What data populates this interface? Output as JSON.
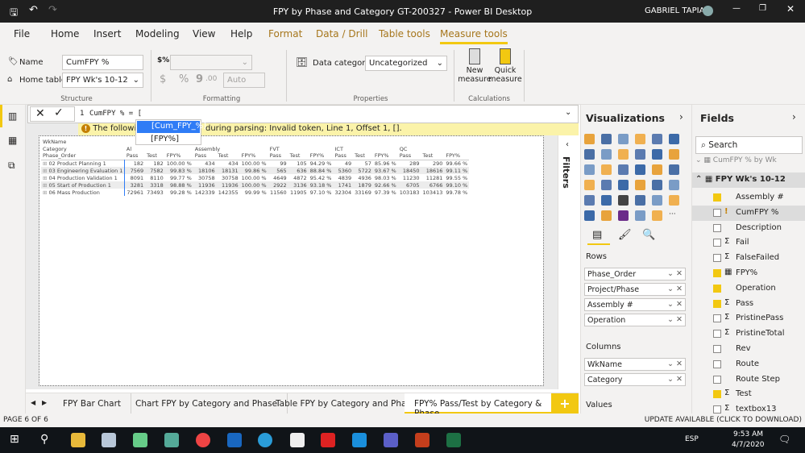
{
  "window": {
    "title": "FPY by Phase and Category GT-200327 - Power BI Desktop",
    "user": "GABRIEL TAPIA"
  },
  "menu": [
    "File",
    "Home",
    "Insert",
    "Modeling",
    "View",
    "Help",
    "Format",
    "Data / Drill",
    "Table tools",
    "Measure tools"
  ],
  "ribbon": {
    "structure": {
      "name_label": "Name",
      "name_value": "CumFPY %",
      "home_table_label": "Home table",
      "home_table_value": "FPY Wk's 10-12",
      "group": "Structure"
    },
    "formatting": {
      "format_value": "",
      "auto_value": "Auto",
      "group": "Formatting",
      "dollar": "$",
      "percent": "%",
      "comma": "9",
      "decimals": ".00"
    },
    "properties": {
      "data_category_label": "Data category",
      "data_category_value": "Uncategorized",
      "group": "Properties"
    },
    "calculations": {
      "new_measure": "New measure",
      "quick_measure": "Quick measure",
      "group": "Calculations"
    }
  },
  "formula": {
    "line": "1",
    "text": "CumFPY % = [",
    "error": "The following syntax error occurred during parsing: Invalid token, Line 1, Offset 1, [].",
    "error_visible": "The following",
    "error_tail": "during parsing: Invalid token, Line 1, Offset 1, [].",
    "autocomplete": [
      "[Cum_FPY_%]",
      "[FPY%]"
    ]
  },
  "matrix": {
    "row_headers": [
      "WkName",
      "Category",
      "Phase_Order"
    ],
    "groups": [
      "Al",
      "Assembly",
      "FVT",
      "ICT",
      "QC"
    ],
    "subcols": [
      "Pass",
      "Test",
      "FPY%"
    ],
    "rows": [
      {
        "label": "02 Product Planning 1",
        "values": [
          "182",
          "182",
          "100.00 %",
          "434",
          "434",
          "100.00 %",
          "99",
          "105",
          "94.29 %",
          "49",
          "57",
          "85.96 %",
          "289",
          "290",
          "99.66 %"
        ]
      },
      {
        "label": "03 Engineering Evaluation 1",
        "values": [
          "7569",
          "7582",
          "99.83 %",
          "18106",
          "18131",
          "99.86 %",
          "565",
          "636",
          "88.84 %",
          "5360",
          "5722",
          "93.67 %",
          "18450",
          "18616",
          "99.11 %"
        ]
      },
      {
        "label": "04 Production Validation 1",
        "values": [
          "8091",
          "8110",
          "99.77 %",
          "30758",
          "30758",
          "100.00 %",
          "4649",
          "4872",
          "95.42 %",
          "4839",
          "4936",
          "98.03 %",
          "11230",
          "11281",
          "99.55 %"
        ]
      },
      {
        "label": "05 Start of Production 1",
        "values": [
          "3281",
          "3318",
          "98.88 %",
          "11936",
          "11936",
          "100.00 %",
          "2922",
          "3136",
          "93.18 %",
          "1741",
          "1879",
          "92.66 %",
          "6705",
          "6766",
          "99.10 %"
        ]
      },
      {
        "label": "06 Mass Production",
        "values": [
          "72961",
          "73493",
          "99.28 %",
          "142339",
          "142355",
          "99.99 %",
          "11560",
          "11905",
          "97.10 %",
          "32304",
          "33169",
          "97.39 %",
          "103183",
          "103413",
          "99.78 %"
        ]
      }
    ]
  },
  "filters_label": "Filters",
  "visualizations": {
    "title": "Visualizations",
    "rows_label": "Rows",
    "rows": [
      "Phase_Order",
      "Project/Phase",
      "Assembly #",
      "Operation"
    ],
    "columns_label": "Columns",
    "columns": [
      "WkName",
      "Category"
    ],
    "values_label": "Values"
  },
  "fields": {
    "title": "Fields",
    "search_placeholder": "Search",
    "table_above": "CumFPY % by Wk",
    "table": "FPY Wk's 10-12",
    "items": [
      {
        "name": "Assembly #",
        "checked": true,
        "sigma": ""
      },
      {
        "name": "CumFPY %",
        "checked": false,
        "sigma": "!"
      },
      {
        "name": "Description",
        "checked": false,
        "sigma": ""
      },
      {
        "name": "Fail",
        "checked": false,
        "sigma": "Σ"
      },
      {
        "name": "FalseFailed",
        "checked": false,
        "sigma": "Σ"
      },
      {
        "name": "FPY%",
        "checked": true,
        "sigma": "▦"
      },
      {
        "name": "Operation",
        "checked": true,
        "sigma": ""
      },
      {
        "name": "Pass",
        "checked": true,
        "sigma": "Σ"
      },
      {
        "name": "PristinePass",
        "checked": false,
        "sigma": "Σ"
      },
      {
        "name": "PristineTotal",
        "checked": false,
        "sigma": "Σ"
      },
      {
        "name": "Rev",
        "checked": false,
        "sigma": ""
      },
      {
        "name": "Route",
        "checked": false,
        "sigma": ""
      },
      {
        "name": "Route Step",
        "checked": false,
        "sigma": ""
      },
      {
        "name": "Test",
        "checked": true,
        "sigma": "Σ"
      },
      {
        "name": "textbox13",
        "checked": false,
        "sigma": "Σ"
      }
    ]
  },
  "tabs": [
    "FPY Bar Chart",
    "Chart FPY by Category and Phase",
    "Table FPY by Category and Phase",
    "FPY% Pass/Test by Category & Phase"
  ],
  "status": {
    "page": "PAGE 6 OF 6",
    "update": "UPDATE AVAILABLE (CLICK TO DOWNLOAD)"
  },
  "taskbar": {
    "time": "9:53 AM",
    "date": "4/7/2020",
    "lang": "ESP"
  },
  "colors": {
    "accent": "#f2c811",
    "titlebar": "#1f1f1f",
    "selection": "#2f7cf6",
    "error_bg": "#fbf3a9"
  }
}
